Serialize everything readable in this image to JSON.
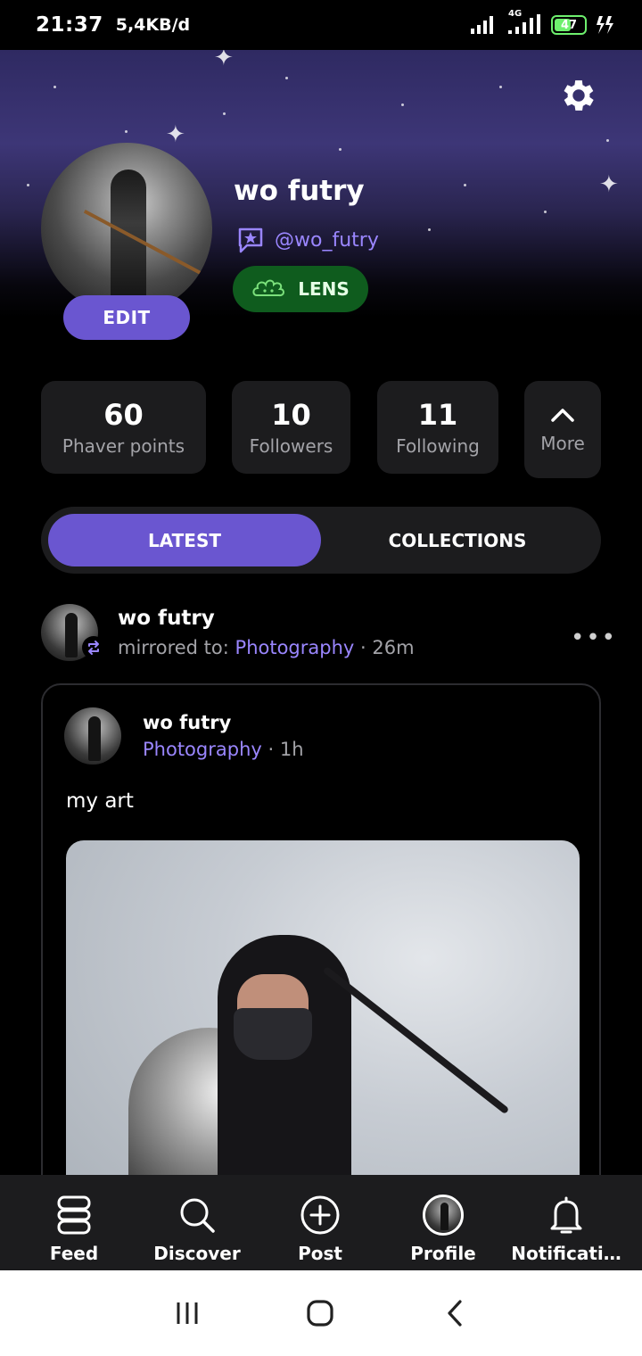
{
  "status_bar": {
    "time": "21:37",
    "net_speed": "5,4KB/d",
    "network_type": "4G",
    "battery": "47",
    "icons": [
      "signal-icon",
      "signal-4g-icon",
      "battery-icon",
      "charging-icon"
    ]
  },
  "profile": {
    "name": "wo futry",
    "handle": "@wo_futry",
    "badge_label": "LENS",
    "edit_label": "EDIT",
    "settings_icon": "gear-icon"
  },
  "stats": [
    {
      "value": "60",
      "label": "Phaver points"
    },
    {
      "value": "10",
      "label": "Followers"
    },
    {
      "value": "11",
      "label": "Following"
    }
  ],
  "more": {
    "label": "More",
    "icon": "chevron-up-icon"
  },
  "tabs": [
    {
      "label": "LATEST",
      "active": true
    },
    {
      "label": "COLLECTIONS",
      "active": false
    }
  ],
  "post": {
    "author": "wo futry",
    "mirror_prefix": "mirrored to:",
    "mirror_target": "Photography",
    "time": "26m",
    "inner": {
      "author": "wo futry",
      "community": "Photography",
      "time": "1h",
      "text": "my art"
    }
  },
  "bottom_nav": [
    {
      "label": "Feed",
      "icon": "feed-icon"
    },
    {
      "label": "Discover",
      "icon": "search-icon"
    },
    {
      "label": "Post",
      "icon": "plus-circle-icon"
    },
    {
      "label": "Profile",
      "icon": "avatar-icon"
    },
    {
      "label": "Notificati…",
      "icon": "bell-icon"
    }
  ],
  "colors": {
    "accent": "#6a56d0",
    "link": "#9a86ff",
    "lens_badge": "#0f5c1e",
    "surface": "#1c1c1e",
    "background": "#000000"
  }
}
